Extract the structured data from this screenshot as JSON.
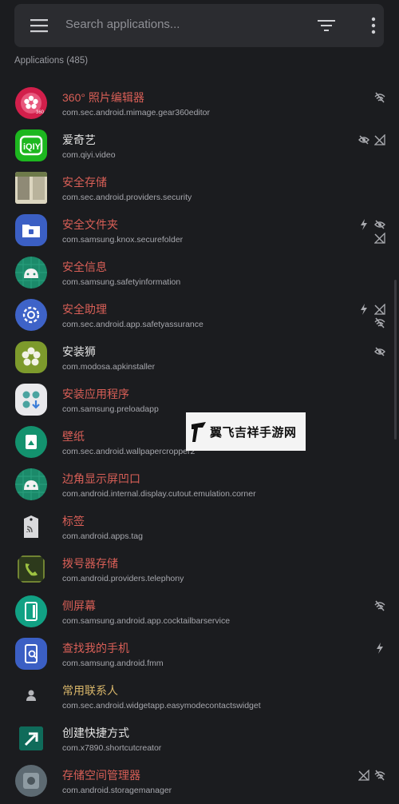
{
  "search": {
    "placeholder": "Search applications..."
  },
  "list_header": "Applications (485)",
  "colors": {
    "system_app": "#d95f57",
    "user_app": "#e3e3e3",
    "highlight_app": "#d8b66a",
    "background": "#1b1c1f"
  },
  "apps": [
    {
      "name": "360° 照片编辑器",
      "package": "com.sec.android.mimage.gear360editor",
      "flags": [
        "wifi-off-icon"
      ]
    },
    {
      "name": "爱奇艺",
      "package": "com.qiyi.video",
      "flags": [
        "eye-off-icon",
        "signal-off-icon"
      ]
    },
    {
      "name": "安全存储",
      "package": "com.sec.android.providers.security",
      "flags": []
    },
    {
      "name": "安全文件夹",
      "package": "com.samsung.knox.securefolder",
      "flags": [
        "bolt-icon",
        "eye-off-icon",
        "signal-off-icon"
      ]
    },
    {
      "name": "安全信息",
      "package": "com.samsung.safetyinformation",
      "flags": []
    },
    {
      "name": "安全助理",
      "package": "com.sec.android.app.safetyassurance",
      "flags": [
        "bolt-icon",
        "signal-off-icon",
        "wifi-off-icon"
      ]
    },
    {
      "name": "安装狮",
      "package": "com.modosa.apkinstaller",
      "flags": [
        "eye-off-icon"
      ]
    },
    {
      "name": "安装应用程序",
      "package": "com.samsung.preloadapp",
      "flags": []
    },
    {
      "name": "壁纸",
      "package": "com.sec.android.wallpapercropper2",
      "flags": []
    },
    {
      "name": "边角显示屏凹口",
      "package": "com.android.internal.display.cutout.emulation.corner",
      "flags": []
    },
    {
      "name": "标签",
      "package": "com.android.apps.tag",
      "flags": []
    },
    {
      "name": "拨号器存储",
      "package": "com.android.providers.telephony",
      "flags": []
    },
    {
      "name": "侧屏幕",
      "package": "com.samsung.android.app.cocktailbarservice",
      "flags": [
        "wifi-off-icon"
      ]
    },
    {
      "name": "查找我的手机",
      "package": "com.samsung.android.fmm",
      "flags": [
        "bolt-icon"
      ]
    },
    {
      "name": "常用联系人",
      "package": "com.sec.android.widgetapp.easymodecontactswidget",
      "flags": []
    },
    {
      "name": "创建快捷方式",
      "package": "com.x7890.shortcutcreator",
      "flags": []
    },
    {
      "name": "存储空间管理器",
      "package": "com.android.storagemanager",
      "flags": [
        "signal-off-icon",
        "wifi-off-icon"
      ]
    }
  ],
  "watermark": {
    "text": "翼飞吉祥手游网"
  }
}
